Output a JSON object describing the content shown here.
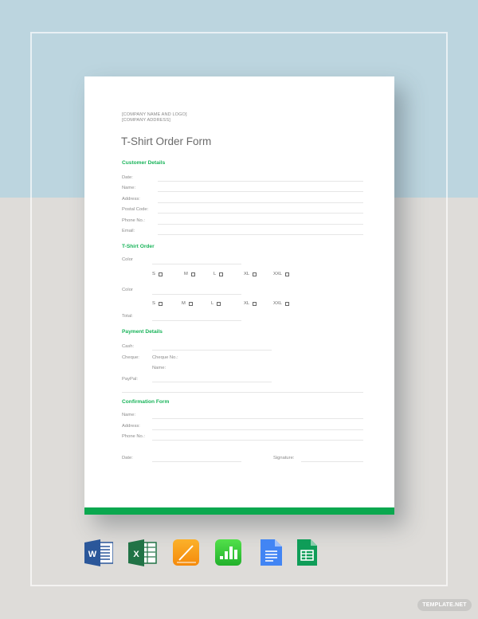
{
  "document": {
    "company_name": "[COMPANY NAME AND LOGO]",
    "company_address": "[COMPANY ADDRESS]",
    "title": "T-Shirt Order Form",
    "accent_color": "#0aa84f",
    "customer_details": {
      "heading": "Customer Details",
      "fields": [
        "Date:",
        "Name:",
        "Address:",
        "Postal Code:",
        "Phone No.:",
        "Email:"
      ]
    },
    "tshirt_order": {
      "heading": "T-Shirt Order",
      "color_label": "Color",
      "sizes": [
        "S",
        "M",
        "L",
        "XL",
        "XXL"
      ],
      "total_label": "Total:"
    },
    "payment_details": {
      "heading": "Payment Details",
      "cash": "Cash:",
      "cheque": "Cheque:",
      "cheque_no": "Cheque No.:",
      "cheque_name": "Name:",
      "paypal": "PayPal:"
    },
    "confirmation_form": {
      "heading": "Confirmation Form",
      "fields": [
        "Name:",
        "Address:",
        "Phone No.:"
      ],
      "date": "Date:",
      "signature": "Signature:"
    }
  },
  "format_icons": [
    {
      "name": "Microsoft Word",
      "letter": "W",
      "color": "#2b579a"
    },
    {
      "name": "Microsoft Excel",
      "letter": "X",
      "color": "#217346"
    },
    {
      "name": "Apple Pages",
      "color": "#f7a012"
    },
    {
      "name": "Apple Numbers",
      "color": "#2fc545"
    },
    {
      "name": "Google Docs",
      "color": "#4285f4"
    },
    {
      "name": "Google Sheets",
      "color": "#0f9d58"
    }
  ],
  "watermark": "TEMPLATE.NET"
}
